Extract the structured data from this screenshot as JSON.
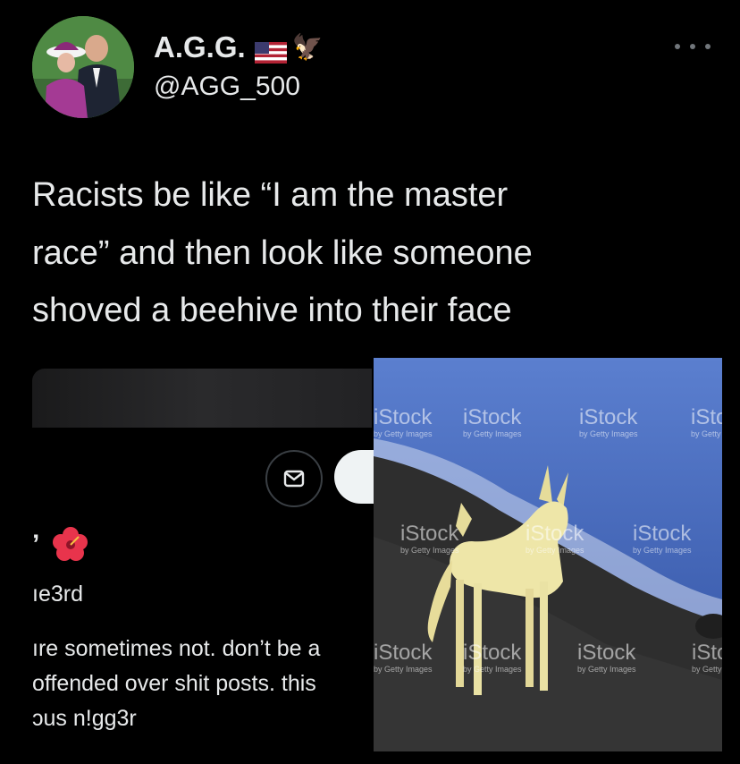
{
  "user": {
    "display_name": "A.G.G.",
    "flag_emoji": "us-flag-icon",
    "eagle_emoji": "🦅",
    "handle": "@AGG_500"
  },
  "tweet": {
    "text": "Racists be like “I am the master\nrace” and then look like someone\nshoved a beehive into their face"
  },
  "quoted_tweet": {
    "name_partial": "’",
    "name_emoji": "hibiscus-icon",
    "handle_partial": "ıe3rd",
    "body_partial": "ıre sometimes not. don’t be a\noffended over shit posts. this\nɔus n!gg3r"
  },
  "stock_image": {
    "watermark_brand": "iStock",
    "watermark_sub": "by Getty Images",
    "colors": {
      "sea": "#3f63b8",
      "sand": "#2e2e2e",
      "dog": "#eee6a8"
    }
  },
  "colors": {
    "background": "#000000",
    "text": "#e7e9ea",
    "muted": "#71767b"
  }
}
